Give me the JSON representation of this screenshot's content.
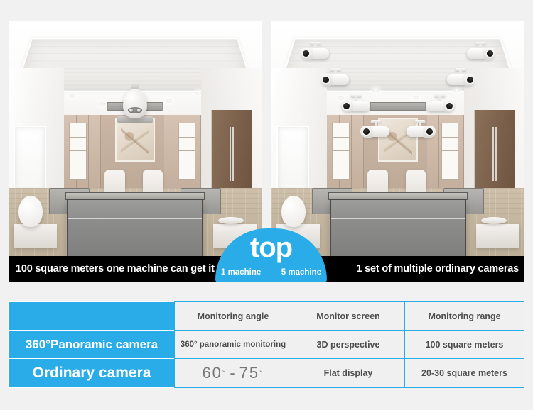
{
  "page": {
    "background_color": "#f1f1f1",
    "accent_color": "#29ace8",
    "caption_bar_color": "#000000"
  },
  "comparison": {
    "left_panel": {
      "scene_name": "office-interior-with-one-panoramic-camera",
      "camera_icon": "panoramic-bulb-camera-icon",
      "camera_count": 1,
      "caption": "100 square meters one machine can get it"
    },
    "right_panel": {
      "scene_name": "office-interior-with-multiple-bullet-cameras",
      "camera_icon": "bullet-camera-icon",
      "camera_count": 8,
      "caption": "1 set of multiple ordinary cameras"
    }
  },
  "top_badge": {
    "title": "top",
    "left_label": "1 machine",
    "right_label": "5 machine",
    "color": "#29ace8"
  },
  "spec_table": {
    "columns": [
      "",
      "Monitoring angle",
      "Monitor screen",
      "Monitoring range"
    ],
    "rows": [
      {
        "label": "360°Panoramic camera",
        "cells": [
          "360° panoramic monitoring",
          "3D perspective",
          "100 square meters"
        ]
      },
      {
        "label": "Ordinary camera",
        "cells": [
          "60° - 75°",
          "Flat display",
          "20-30 square meters"
        ],
        "angle_min": "60",
        "angle_max": "75",
        "angle_separator": "-",
        "degree_symbol": "°"
      }
    ]
  }
}
